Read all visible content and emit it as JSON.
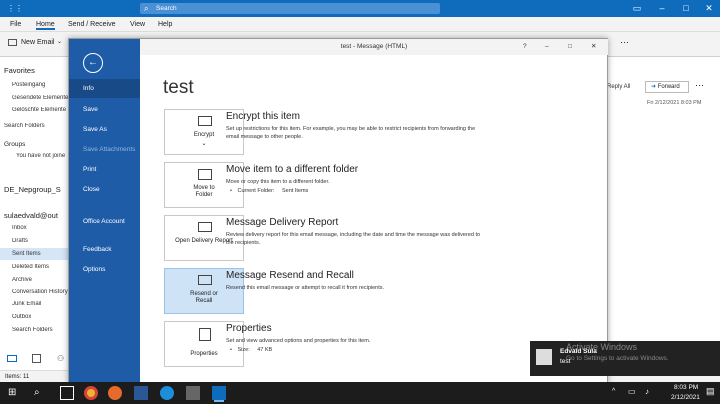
{
  "outlook": {
    "search_placeholder": "Search",
    "tabs": [
      "File",
      "Home",
      "Send / Receive",
      "View",
      "Help"
    ],
    "new_email": "New Email",
    "reply_all": "Reply All",
    "forward": "Forward",
    "date": "Fri 2/12/2021 8:03 PM",
    "status_items": "Items: 11",
    "nav": {
      "favorites": "Favorites",
      "fav_items": [
        "Posteingang",
        "Gesendete Elemente",
        "Gelöschte Elemente"
      ],
      "search_folders": "Search Folders",
      "groups": "Groups",
      "groups_msg": "You have not joine",
      "account1": "DE_Nepgroup_S",
      "account2": "sulaedvald@out",
      "folders": [
        "Inbox",
        "Drafts",
        "Sent Items",
        "Deleted Items",
        "Archive",
        "Conversation History",
        "Junk Email",
        "Outbox",
        "Search Folders"
      ]
    }
  },
  "dialog": {
    "title": "test  -  Message (HTML)",
    "heading": "test",
    "help": "?",
    "backstage_items": [
      "Info",
      "Save",
      "Save As",
      "Save Attachments",
      "Print",
      "Close",
      "Office Account",
      "Feedback",
      "Options"
    ],
    "sections": [
      {
        "card": "Encrypt",
        "heading": "Encrypt this item",
        "desc": "Set up restrictions for this item. For example, you may be able to restrict recipients from forwarding the email message to other people."
      },
      {
        "card": "Move to Folder",
        "heading": "Move item to a different folder",
        "desc": "Move or copy this item to a different folder.",
        "bullet_label": "Current Folder:",
        "bullet_value": "Sent Items"
      },
      {
        "card": "Open Delivery Report",
        "heading": "Message Delivery Report",
        "desc": "Review delivery report for this email message, including the date and time the message was delivered to the recipients."
      },
      {
        "card": "Resend or Recall",
        "heading": "Message Resend and Recall",
        "desc": "Resend this email message or attempt to recall it from recipients."
      },
      {
        "card": "Properties",
        "heading": "Properties",
        "desc": "Set and view advanced options and properties for this item.",
        "bullet_label": "Size:",
        "bullet_value": "47 KB"
      }
    ]
  },
  "notification": {
    "name": "Edvald Sula",
    "text": "test"
  },
  "watermark": {
    "title": "Activate Windows",
    "text": "Go to Settings to activate Windows."
  },
  "taskbar": {
    "time": "8:03 PM",
    "date": "2/12/2021"
  },
  "colors": {
    "accent": "#1e5ca8",
    "titlebar": "#0f6cbd",
    "selected_card": "#cfe3f7"
  }
}
